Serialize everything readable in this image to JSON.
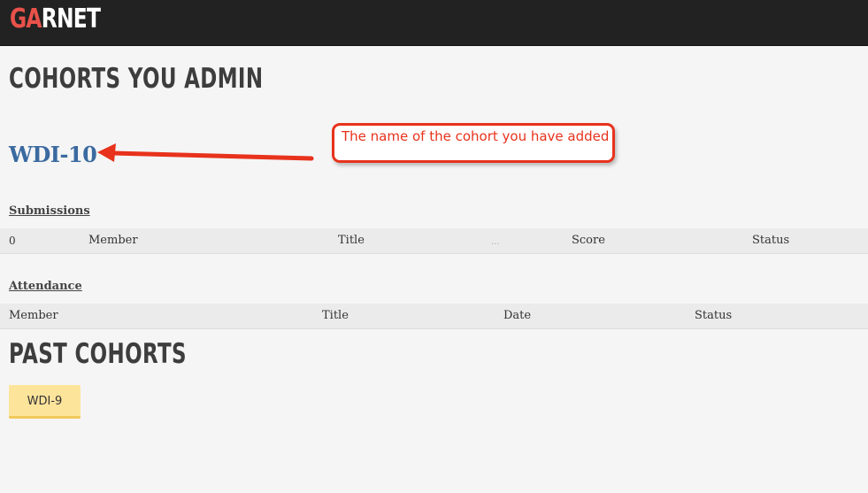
{
  "app": {
    "logo_part1": "GA",
    "logo_part2": "RNET"
  },
  "admin_section": {
    "heading": "COHORTS YOU ADMIN",
    "cohort_name": "WDI-10"
  },
  "annotation": {
    "text": "The name of the cohort you have added"
  },
  "submissions": {
    "label": "Submissions",
    "columns": [
      "0",
      "Member",
      "Title",
      "...",
      "Score",
      "Status"
    ]
  },
  "attendance": {
    "label": "Attendance",
    "columns": [
      "Member",
      "Title",
      "Date",
      "Status"
    ]
  },
  "past_section": {
    "heading": "PAST COHORTS",
    "cohorts": [
      "WDI-9"
    ]
  },
  "colors": {
    "topbar": "#222222",
    "logo_accent": "#e8524a",
    "link": "#3b6aa0",
    "annotation": "#e8321c",
    "past_button": "#fde49b"
  }
}
